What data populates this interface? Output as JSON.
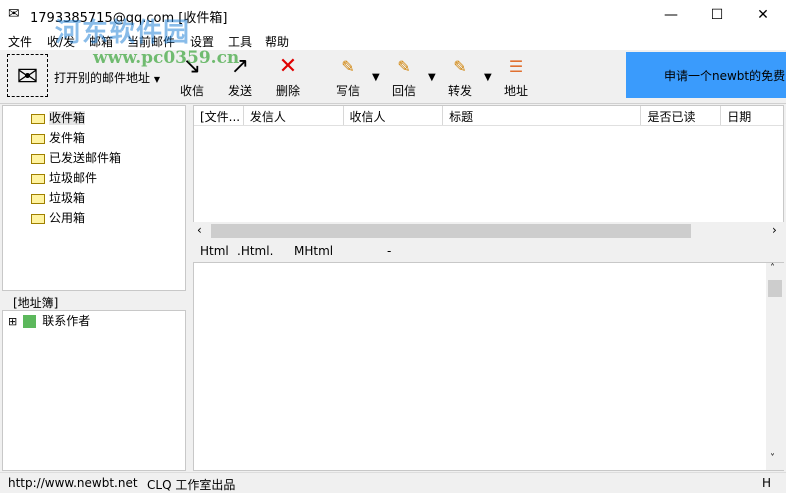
{
  "window": {
    "title": "1793385715@qq.com [收件箱]",
    "minimize": "—",
    "maximize": "☐",
    "close": "✕"
  },
  "menu": [
    "文件",
    "收/发",
    "邮箱",
    "当前邮件",
    "设置",
    "工具",
    "帮助"
  ],
  "toolbar": {
    "open_other": "打开别的邮件地址",
    "receive": "收信",
    "send": "发送",
    "delete": "删除",
    "compose": "写信",
    "reply": "回信",
    "forward": "转发",
    "address": "地址"
  },
  "banner": "申请一个newbt的免费邮箱",
  "folders": [
    "收件箱",
    "发件箱",
    "已发送邮件箱",
    "垃圾邮件",
    "垃圾箱",
    "公用箱"
  ],
  "address_book": {
    "label": "[地址簿]",
    "items": [
      "联系作者"
    ]
  },
  "list": {
    "columns": [
      "[文件...",
      "发信人",
      "收信人",
      "标题",
      "是否已读",
      "日期"
    ]
  },
  "preview_toolbar": [
    "Html",
    ".Html.",
    "MHtml",
    "-"
  ],
  "status": {
    "url": "http://www.newbt.net",
    "credit": "CLQ 工作室出品",
    "mode": "H"
  },
  "watermark": {
    "name": "河东软件园",
    "url": "www.pc0359.cn"
  }
}
